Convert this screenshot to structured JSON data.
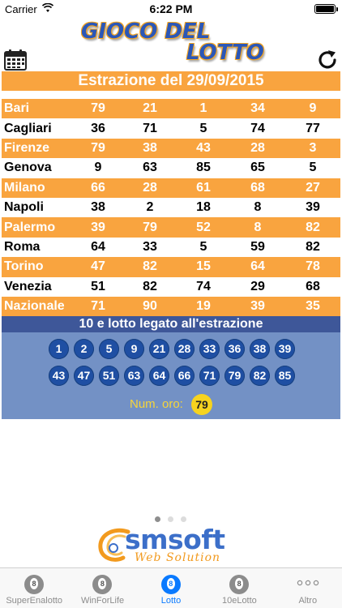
{
  "status_bar": {
    "carrier": "Carrier",
    "time": "6:22 PM"
  },
  "header": {
    "logo_line1": "GIOCO DEL",
    "logo_line2": "LOTTO",
    "calendar_icon": "calendar-icon",
    "refresh_icon": "refresh-icon"
  },
  "title": "Estrazione del 29/09/2015",
  "results": [
    {
      "city": "Bari",
      "numbers": [
        "79",
        "21",
        "1",
        "34",
        "9"
      ]
    },
    {
      "city": "Cagliari",
      "numbers": [
        "36",
        "71",
        "5",
        "74",
        "77"
      ]
    },
    {
      "city": "Firenze",
      "numbers": [
        "79",
        "38",
        "43",
        "28",
        "3"
      ]
    },
    {
      "city": "Genova",
      "numbers": [
        "9",
        "63",
        "85",
        "65",
        "5"
      ]
    },
    {
      "city": "Milano",
      "numbers": [
        "66",
        "28",
        "61",
        "68",
        "27"
      ]
    },
    {
      "city": "Napoli",
      "numbers": [
        "38",
        "2",
        "18",
        "8",
        "39"
      ]
    },
    {
      "city": "Palermo",
      "numbers": [
        "39",
        "79",
        "52",
        "8",
        "82"
      ]
    },
    {
      "city": "Roma",
      "numbers": [
        "64",
        "33",
        "5",
        "59",
        "82"
      ]
    },
    {
      "city": "Torino",
      "numbers": [
        "47",
        "82",
        "15",
        "64",
        "78"
      ]
    },
    {
      "city": "Venezia",
      "numbers": [
        "51",
        "82",
        "74",
        "29",
        "68"
      ]
    },
    {
      "city": "Nazionale",
      "numbers": [
        "71",
        "90",
        "19",
        "39",
        "35"
      ]
    }
  ],
  "diecielotto": {
    "header": "10 e lotto legato all'estrazione",
    "row1": [
      "1",
      "2",
      "5",
      "9",
      "21",
      "28",
      "33",
      "36",
      "38",
      "39"
    ],
    "row2": [
      "43",
      "47",
      "51",
      "63",
      "64",
      "66",
      "71",
      "79",
      "82",
      "85"
    ],
    "oro_label": "Num. oro:",
    "oro_value": "79"
  },
  "pager": {
    "pages": 3,
    "current": 1
  },
  "brand": {
    "name": "smsoft",
    "subtitle": "Web Solution"
  },
  "tabs": [
    {
      "label": "SuperEnalotto",
      "icon": "lottery-ball-icon",
      "active": false
    },
    {
      "label": "WinForLife",
      "icon": "lottery-ball-icon",
      "active": false
    },
    {
      "label": "Lotto",
      "icon": "lottery-ball-icon",
      "active": true
    },
    {
      "label": "10eLotto",
      "icon": "lottery-ball-icon",
      "active": false
    },
    {
      "label": "Altro",
      "icon": "more-icon",
      "active": false
    }
  ],
  "colors": {
    "accent_orange": "#f9a43f",
    "panel_blue": "#7391c5",
    "panel_header": "#3e5799",
    "ball_blue": "#1f4fa3",
    "gold": "#f6d31f",
    "tab_active": "#0a7aff"
  }
}
